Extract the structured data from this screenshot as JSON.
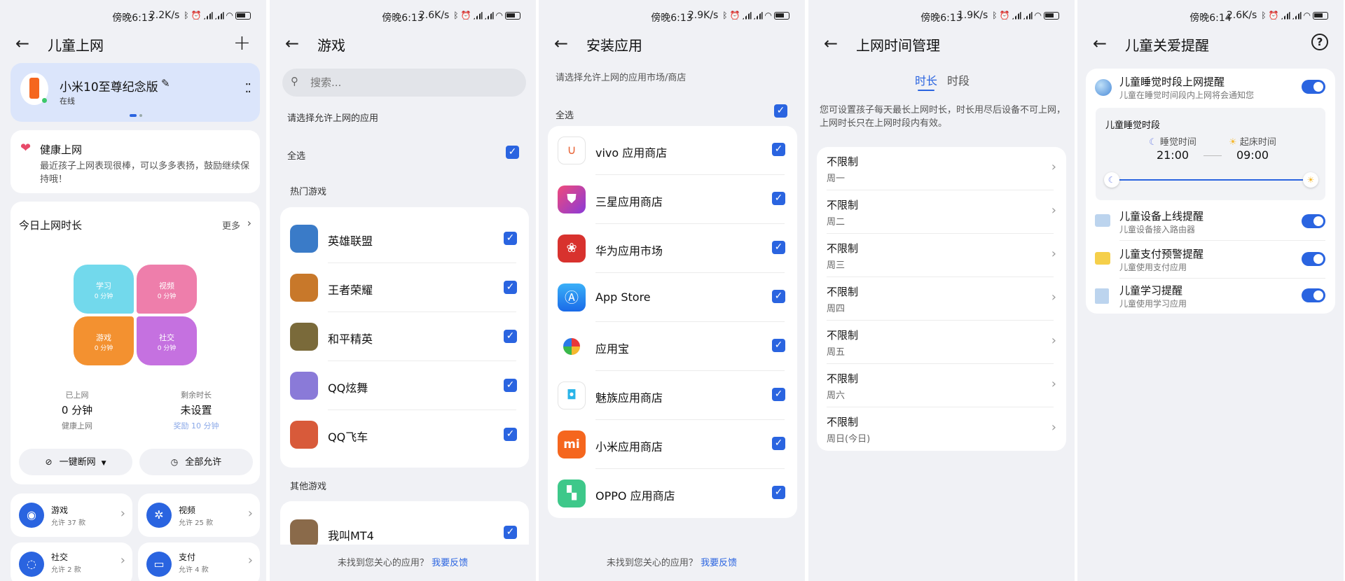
{
  "screens": [
    {
      "time": "傍晚6:13",
      "speed": "2.2K/s"
    },
    {
      "time": "傍晚6:13",
      "speed": "2.6K/s"
    },
    {
      "time": "傍晚6:13",
      "speed": "2.9K/s"
    },
    {
      "time": "傍晚6:13",
      "speed": "1.9K/s"
    },
    {
      "time": "傍晚6:14",
      "speed": "2.6K/s"
    }
  ],
  "s1": {
    "title": "儿童上网",
    "device": {
      "name": "小米10至尊纪念版",
      "status": "在线"
    },
    "health": {
      "title": "健康上网",
      "desc": "最近孩子上网表现很棒，可以多多表扬，鼓励继续保持哦！"
    },
    "today": {
      "title": "今日上网时长",
      "more": "更多"
    },
    "tiles": [
      {
        "label": "学习",
        "value": "0 分钟",
        "color": "#72d9ec"
      },
      {
        "label": "视频",
        "value": "0 分钟",
        "color": "#ee7eab"
      },
      {
        "label": "游戏",
        "value": "0 分钟",
        "color": "#f39130"
      },
      {
        "label": "社交",
        "value": "0 分钟",
        "color": "#c571e0"
      }
    ],
    "used": {
      "label": "已上网",
      "value": "0 分钟",
      "sub": "健康上网"
    },
    "remain": {
      "label": "剩余时长",
      "value": "未设置",
      "sub": "奖励 10 分钟"
    },
    "btn_cut": "一键断网",
    "btn_allow": "全部允许",
    "cats": [
      {
        "name": "游戏",
        "sub": "允许 37 款"
      },
      {
        "name": "视频",
        "sub": "允许 25 款"
      },
      {
        "name": "社交",
        "sub": "允许 2 款"
      },
      {
        "name": "支付",
        "sub": "允许 4 款"
      }
    ]
  },
  "s2": {
    "title": "游戏",
    "search_placeholder": "搜索...",
    "prompt": "请选择允许上网的应用",
    "select_all": "全选",
    "hot": "热门游戏",
    "games": [
      {
        "name": "英雄联盟",
        "color": "#3a7bc8"
      },
      {
        "name": "王者荣耀",
        "color": "#c8782a"
      },
      {
        "name": "和平精英",
        "color": "#7a6a3a"
      },
      {
        "name": "QQ炫舞",
        "color": "#8a7ad8"
      },
      {
        "name": "QQ飞车",
        "color": "#d85a3a"
      }
    ],
    "other": "其他游戏",
    "other_games": [
      {
        "name": "我叫MT4",
        "color": "#8a6a4a"
      }
    ],
    "footer": "未找到您关心的应用？",
    "feedback": "我要反馈"
  },
  "s3": {
    "title": "安装应用",
    "prompt": "请选择允许上网的应用市场/商店",
    "select_all": "全选",
    "apps": [
      {
        "name": "vivo 应用商店",
        "color": "#ffffff"
      },
      {
        "name": "三星应用商店",
        "color": "#d63a8c"
      },
      {
        "name": "华为应用市场",
        "color": "#d8322e"
      },
      {
        "name": "App Store",
        "color": "#2e8ff0"
      },
      {
        "name": "应用宝",
        "color": "#ffffff"
      },
      {
        "name": "魅族应用商店",
        "color": "#ffffff"
      },
      {
        "name": "小米应用商店",
        "color": "#f5661e"
      },
      {
        "name": "OPPO 应用商店",
        "color": "#3ec88a"
      }
    ],
    "footer": "未找到您关心的应用？",
    "feedback": "我要反馈"
  },
  "s4": {
    "title": "上网时间管理",
    "tab_duration": "时长",
    "tab_period": "时段",
    "desc": "您可设置孩子每天最长上网时长，时长用尽后设备不可上网，上网时长只在上网时段内有效。",
    "days": [
      {
        "value": "不限制",
        "day": "周一"
      },
      {
        "value": "不限制",
        "day": "周二"
      },
      {
        "value": "不限制",
        "day": "周三"
      },
      {
        "value": "不限制",
        "day": "周四"
      },
      {
        "value": "不限制",
        "day": "周五"
      },
      {
        "value": "不限制",
        "day": "周六"
      },
      {
        "value": "不限制",
        "day": "周日(今日)"
      }
    ]
  },
  "s5": {
    "title": "儿童关爱提醒",
    "sleep": {
      "title": "儿童睡觉时段上网提醒",
      "desc": "儿童在睡觉时间段内上网将会通知您",
      "enabled": true
    },
    "sleep_panel": {
      "title": "儿童睡觉时段",
      "sleep_label": "睡觉时间",
      "sleep_time": "21:00",
      "wake_label": "起床时间",
      "wake_time": "09:00"
    },
    "items": [
      {
        "title": "儿童设备上线提醒",
        "desc": "儿童设备接入路由器",
        "enabled": true,
        "color": "#bcd4ee"
      },
      {
        "title": "儿童支付预警提醒",
        "desc": "儿童使用支付应用",
        "enabled": true,
        "color": "#f5cf4a"
      },
      {
        "title": "儿童学习提醒",
        "desc": "儿童使用学习应用",
        "enabled": true,
        "color": "#bcd4ee"
      }
    ]
  }
}
